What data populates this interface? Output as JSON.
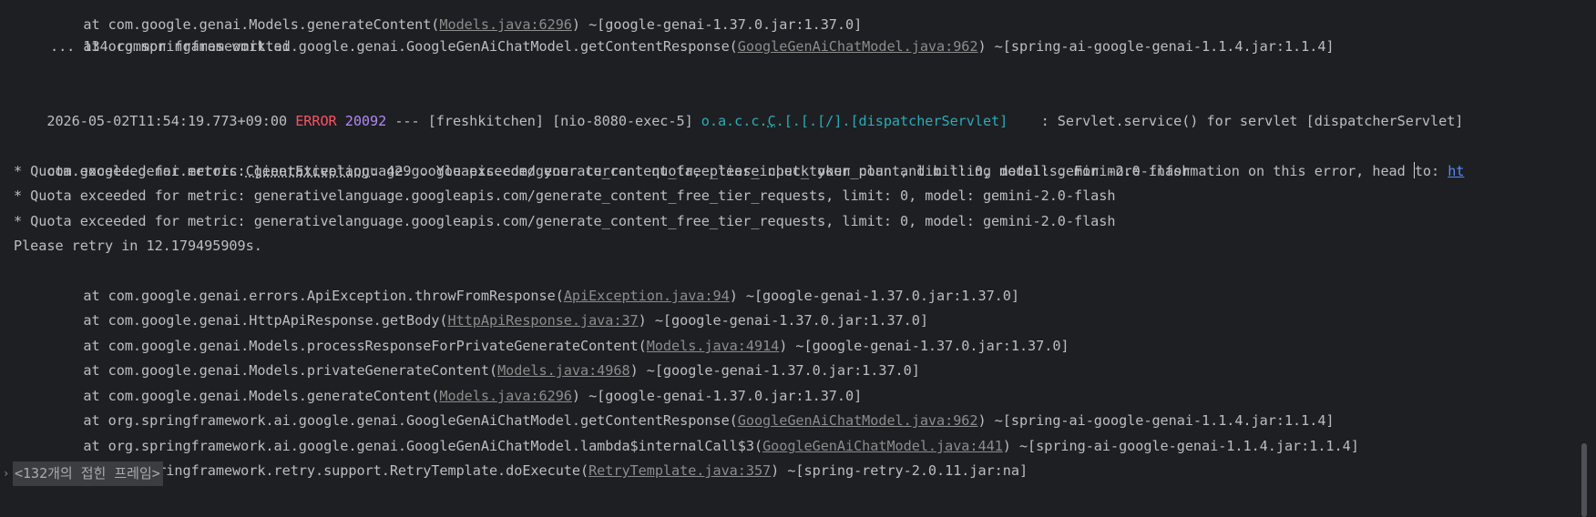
{
  "console": {
    "top_lines": [
      {
        "prefix": "at com.google.genai.Models.generateContent(",
        "link": "Models.java:6296",
        "suffix": ") ~[google-genai-1.37.0.jar:1.37.0]"
      },
      {
        "prefix": "at org.springframework.ai.google.genai.GoogleGenAiChatModel.getContentResponse(",
        "link": "GoogleGenAiChatModel.java:962",
        "suffix": ") ~[spring-ai-google-genai-1.1.4.jar:1.1.4]"
      }
    ],
    "omitted": "... 134 common frames omitted",
    "log_line": {
      "timestamp": "2026-05-02T11:54:19.773+09:00",
      "level": "ERROR",
      "pid": "20092",
      "separator": "---",
      "app": "[freshkitchen]",
      "thread": "[nio-8080-exec-5]",
      "logger_pre": "o.a.c.c.",
      "logger_c": "C",
      "logger_post": ".[.[.[/].[dispatcherServlet]",
      "message": ": Servlet.service() for servlet [dispatcherServlet]"
    },
    "exception": {
      "pkg": "com.google.genai.errors.",
      "cls": "ClientException",
      "message_a": ": 429 . You exceeded your current quota, please check your plan and billing details. For more information on this error, head ",
      "message_b": "to: ",
      "url": "ht"
    },
    "quota_lines": [
      "* Quota exceeded for metric: generativelanguage.googleapis.com/generate_content_free_tier_input_token_count, limit: 0, model: gemini-2.0-flash",
      "* Quota exceeded for metric: generativelanguage.googleapis.com/generate_content_free_tier_requests, limit: 0, model: gemini-2.0-flash",
      "* Quota exceeded for metric: generativelanguage.googleapis.com/generate_content_free_tier_requests, limit: 0, model: gemini-2.0-flash"
    ],
    "retry_line": "Please retry in 12.179495909s.",
    "stack_frames": [
      {
        "prefix": "at com.google.genai.errors.ApiException.throwFromResponse(",
        "link": "ApiException.java:94",
        "suffix": ") ~[google-genai-1.37.0.jar:1.37.0]"
      },
      {
        "prefix": "at com.google.genai.HttpApiResponse.getBody(",
        "link": "HttpApiResponse.java:37",
        "suffix": ") ~[google-genai-1.37.0.jar:1.37.0]"
      },
      {
        "prefix": "at com.google.genai.Models.processResponseForPrivateGenerateContent(",
        "link": "Models.java:4914",
        "suffix": ") ~[google-genai-1.37.0.jar:1.37.0]"
      },
      {
        "prefix": "at com.google.genai.Models.privateGenerateContent(",
        "link": "Models.java:4968",
        "suffix": ") ~[google-genai-1.37.0.jar:1.37.0]"
      },
      {
        "prefix": "at com.google.genai.Models.generateContent(",
        "link": "Models.java:6296",
        "suffix": ") ~[google-genai-1.37.0.jar:1.37.0]"
      },
      {
        "prefix": "at org.springframework.ai.google.genai.GoogleGenAiChatModel.getContentResponse(",
        "link": "GoogleGenAiChatModel.java:962",
        "suffix": ") ~[spring-ai-google-genai-1.1.4.jar:1.1.4]"
      },
      {
        "prefix": "at org.springframework.ai.google.genai.GoogleGenAiChatModel.lambda$internalCall$3(",
        "link": "GoogleGenAiChatModel.java:441",
        "suffix": ") ~[spring-ai-google-genai-1.1.4.jar:1.1.4]"
      },
      {
        "prefix": "at org.springframework.retry.support.RetryTemplate.doExecute(",
        "link": "RetryTemplate.java:357",
        "suffix": ") ~[spring-retry-2.0.11.jar:na]"
      }
    ],
    "folded_frames": "<132개의 접힌 프레임>",
    "fold_chevron": "›"
  },
  "colors": {
    "background": "#1e1f22",
    "text": "#bcbec4",
    "error": "#f75464",
    "pid": "#b189f5",
    "logger": "#2aacb8",
    "link": "#8c8c8c",
    "url": "#548af7"
  }
}
